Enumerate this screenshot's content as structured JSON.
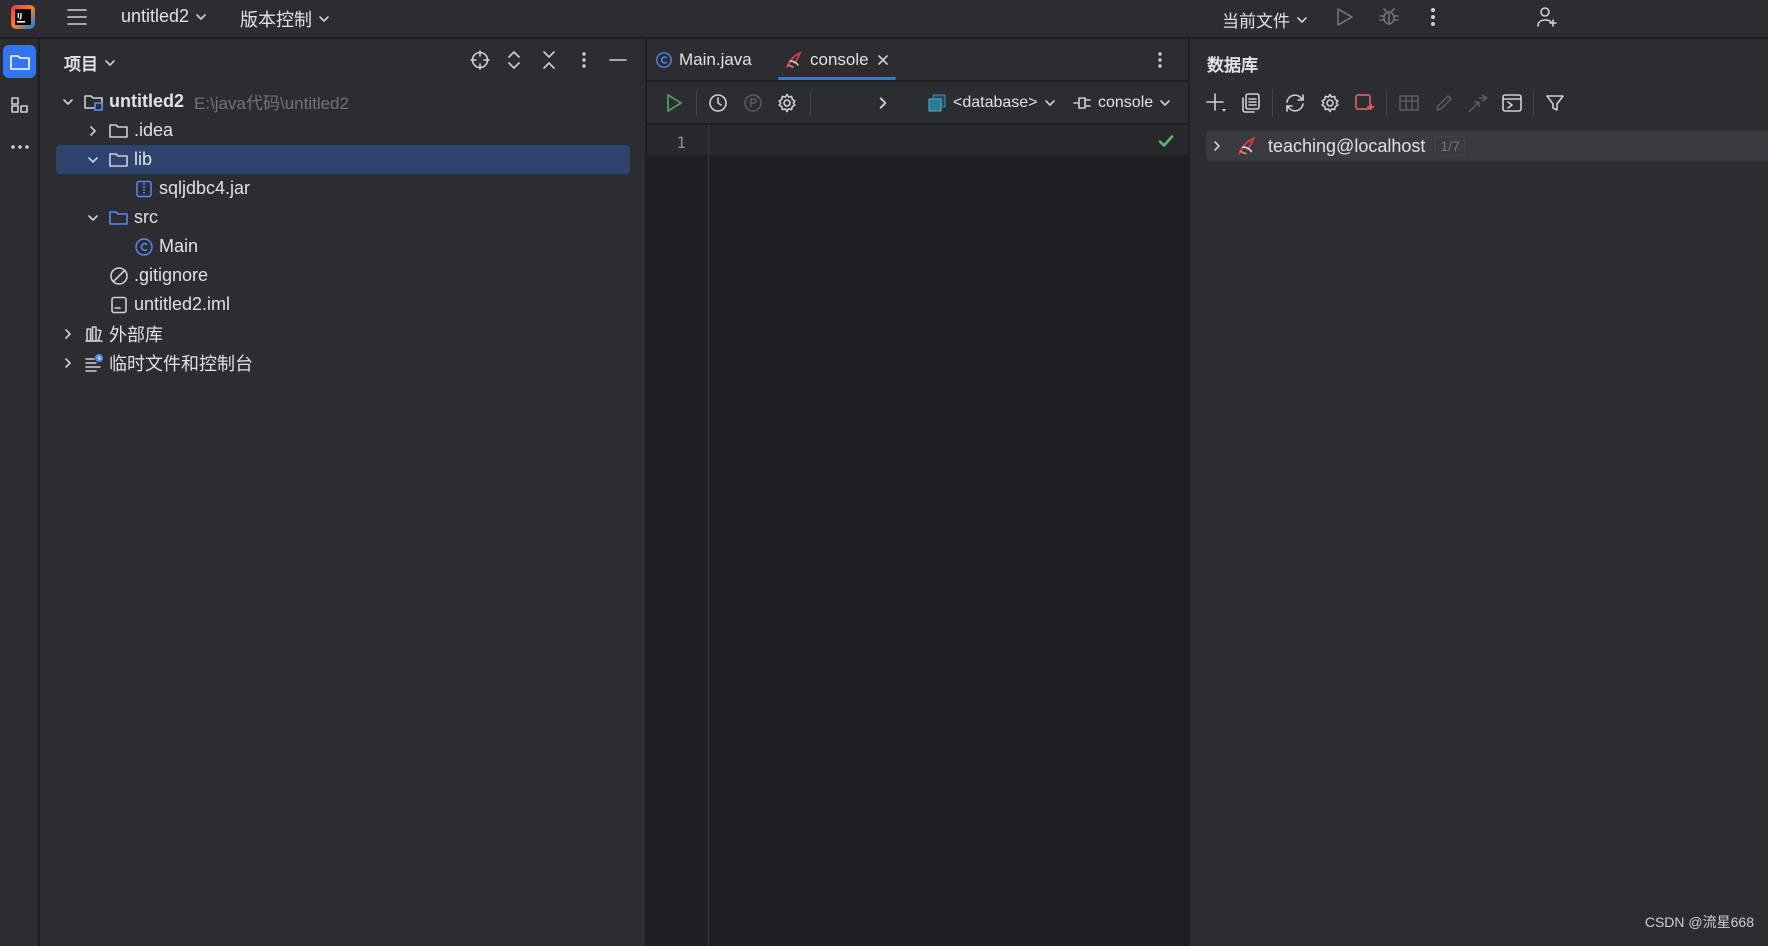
{
  "titlebar": {
    "project_name": "untitled2",
    "vcs_menu": "版本控制",
    "run_config": "当前文件"
  },
  "project_panel": {
    "title": "项目",
    "tree": [
      {
        "label": "untitled2",
        "hint": "E:\\java代码\\untitled2",
        "icon": "project-folder-icon"
      },
      {
        "label": ".idea",
        "icon": "folder-icon"
      },
      {
        "label": "lib",
        "icon": "folder-icon",
        "selected": true
      },
      {
        "label": "sqljdbc4.jar",
        "icon": "jar-icon"
      },
      {
        "label": "src",
        "icon": "source-folder-icon"
      },
      {
        "label": "Main",
        "icon": "class-icon"
      },
      {
        "label": ".gitignore",
        "icon": "ignore-file-icon"
      },
      {
        "label": "untitled2.iml",
        "icon": "module-file-icon"
      },
      {
        "label": "外部库",
        "icon": "library-icon"
      },
      {
        "label": "临时文件和控制台",
        "icon": "scratches-icon"
      }
    ]
  },
  "editor": {
    "tabs": [
      {
        "label": "Main.java",
        "active": false
      },
      {
        "label": "console",
        "active": true
      }
    ],
    "database_selector": "<database>",
    "session_selector": "console",
    "line_numbers": [
      "1"
    ]
  },
  "database_panel": {
    "title": "数据库",
    "datasources": [
      {
        "label": "teaching@localhost",
        "badge": "1/7"
      }
    ]
  },
  "watermark": "CSDN @流星668",
  "colors": {
    "accent": "#3574f0",
    "panel_bg": "#2b2d30",
    "editor_bg": "#1e1f22",
    "selection": "#2e436e",
    "run_green": "#57965c",
    "ok_green": "#5fb865"
  }
}
